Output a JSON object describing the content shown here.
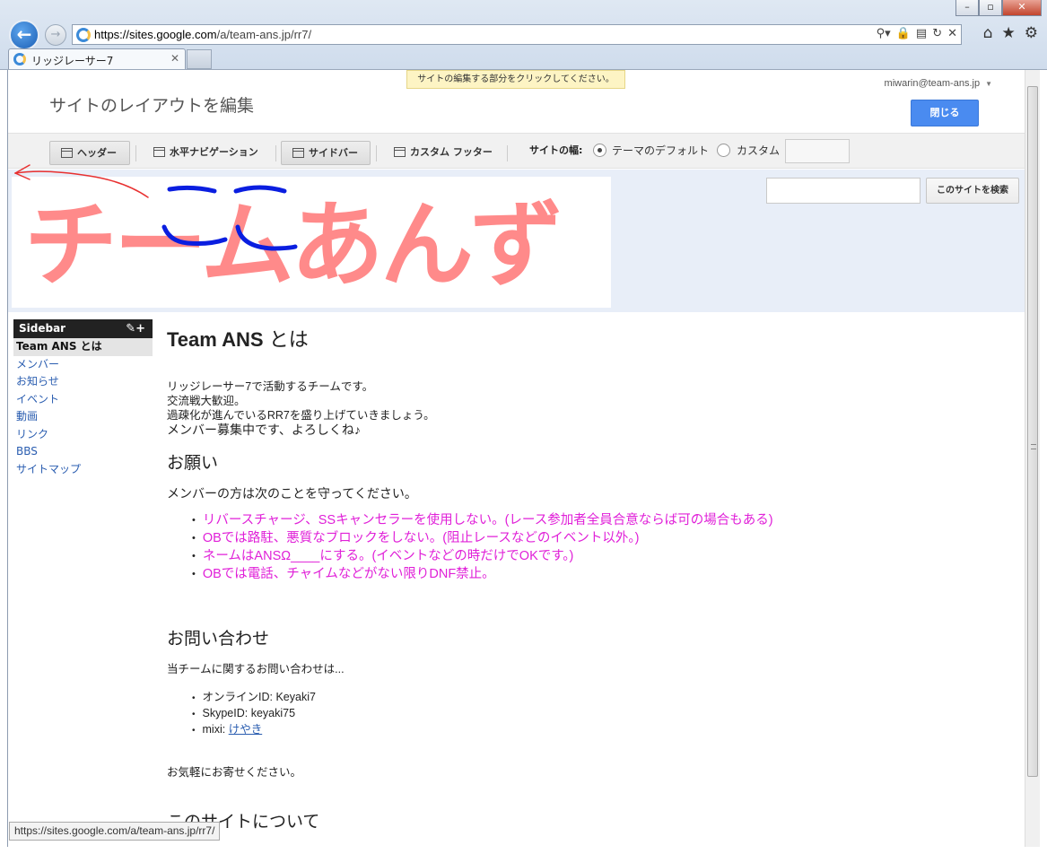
{
  "browser": {
    "url_host": "https://sites.google.com",
    "url_path": "/a/team-ans.jp/rr7/",
    "tab_title": "リッジレーサー7",
    "status_url": "https://sites.google.com/a/team-ans.jp/rr7/"
  },
  "editor": {
    "hint": "サイトの編集する部分をクリックしてください。",
    "title": "サイトのレイアウトを編集",
    "account": "miwarin@team-ans.jp",
    "close_label": "閉じる",
    "layout_buttons": [
      {
        "label": "ヘッダー",
        "active": true
      },
      {
        "label": "水平ナビゲーション",
        "active": false
      },
      {
        "label": "サイドバー",
        "active": true
      },
      {
        "label": "カスタム フッター",
        "active": false
      }
    ],
    "width_label": "サイトの幅:",
    "width_options": [
      {
        "label": "テーマのデフォルト",
        "selected": true
      },
      {
        "label": "カスタム",
        "selected": false
      }
    ]
  },
  "header": {
    "logo_text": "チームあんず",
    "annotation_text": "ここ",
    "search_placeholder": "",
    "search_button": "このサイトを検索"
  },
  "sidebar": {
    "title": "Sidebar",
    "items": [
      {
        "label": "Team ANS とは",
        "current": true
      },
      {
        "label": "メンバー",
        "current": false
      },
      {
        "label": "お知らせ",
        "current": false
      },
      {
        "label": "イベント",
        "current": false
      },
      {
        "label": "動画",
        "current": false
      },
      {
        "label": "リンク",
        "current": false
      },
      {
        "label": "BBS",
        "current": false
      },
      {
        "label": "サイトマップ",
        "current": false
      }
    ]
  },
  "main": {
    "title_bold": "Team ANS",
    "title_rest": " とは",
    "intro": [
      "リッジレーサー7で活動するチームです。",
      "交流戦大歓迎。",
      "過疎化が進んでいるRR7を盛り上げていきましょう。"
    ],
    "intro_big": "メンバー募集中です、よろしくね♪",
    "request_heading": "お願い",
    "request_lead": "メンバーの方は次のことを守ってください。",
    "rules": [
      "リバースチャージ、SSキャンセラーを使用しない。(レース参加者全員合意ならば可の場合もある)",
      "OBでは路駐、悪質なブロックをしない。(阻止レースなどのイベント以外。)",
      "ネームはANSΩ____にする。(イベントなどの時だけでOKです。)",
      "OBでは電話、チャイムなどがない限りDNF禁止。"
    ],
    "contact_heading": "お問い合わせ",
    "contact_lead": "当チームに関するお問い合わせは...",
    "contacts": [
      {
        "label": "オンラインID: Keyaki7"
      },
      {
        "label": "SkypeID: keyaki75"
      }
    ],
    "mixi_label": "mixi: ",
    "mixi_link": "けやき",
    "contact_footer": "お気軽にお寄せください。",
    "about_heading": "このサイトについて"
  },
  "colors": {
    "logo_pink": "#ff8a8a",
    "annotation_blue": "#0a1ee0",
    "annotation_red": "#e83030",
    "rule_magenta": "#e020d8",
    "close_button": "#4a8bf0"
  }
}
